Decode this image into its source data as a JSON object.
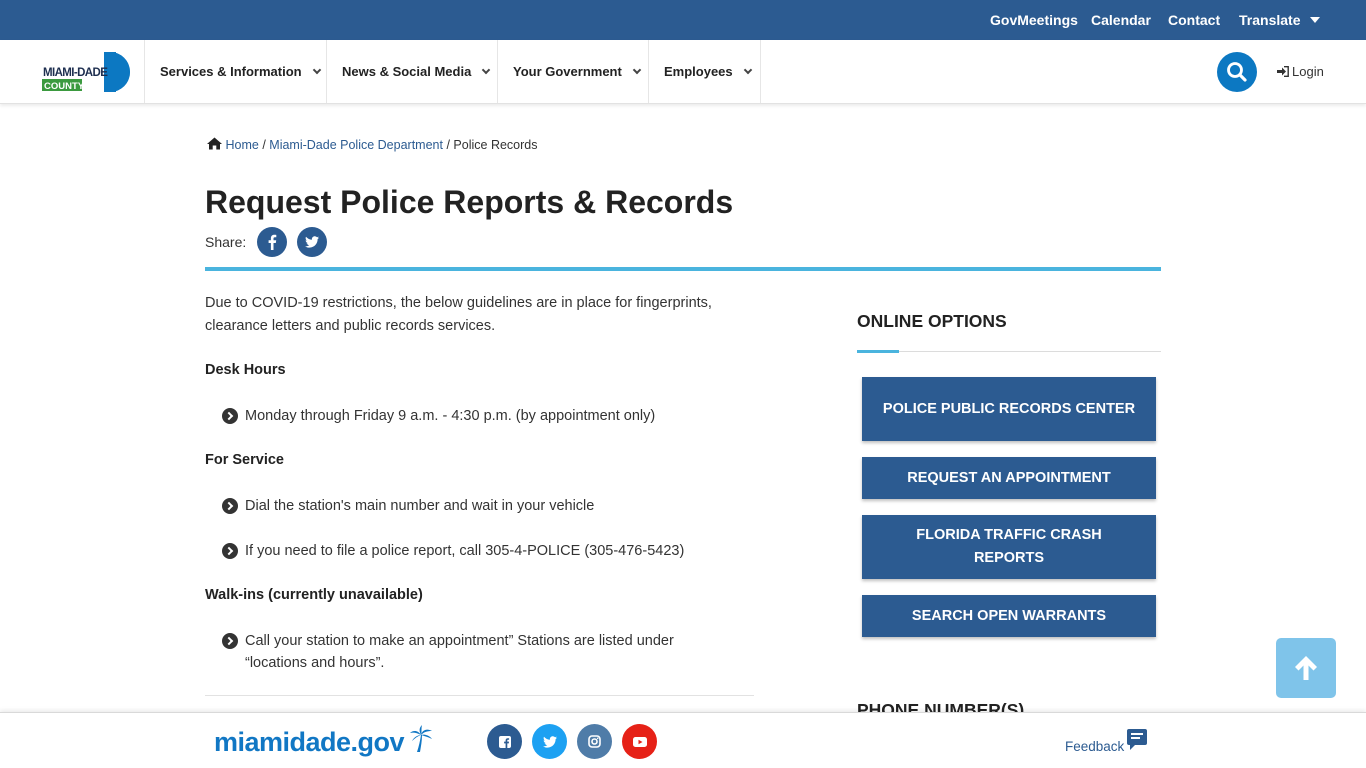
{
  "topbar": {
    "links": [
      "GovMeetings",
      "Calendar",
      "Contact"
    ],
    "translate_label": "Translate"
  },
  "logo": {
    "line1": "MIAMI-DADE",
    "line2": "COUNTY"
  },
  "nav": {
    "items": [
      "Services & Information",
      "News & Social Media",
      "Your Government",
      "Employees"
    ],
    "login_label": "Login"
  },
  "breadcrumb": {
    "home": "Home",
    "separator": "/",
    "department": "Miami-Dade Police Department",
    "current": "Police Records"
  },
  "page": {
    "title": "Request Police Reports & Records",
    "share_label": "Share:",
    "intro": "Due to COVID-19 restrictions, the below guidelines are in place for fingerprints, clearance letters and public records services.",
    "sections": [
      {
        "heading": "Desk Hours",
        "items": [
          "Monday through Friday 9 a.m. - 4:30 p.m. (by appointment only)"
        ]
      },
      {
        "heading": "For Service",
        "items": [
          "Dial the station's main number and wait in your vehicle",
          "If you need to file a police report, call 305-4-POLICE (305-476-5423)"
        ]
      },
      {
        "heading": "Walk-ins (currently unavailable)",
        "items": [
          "Call your station to make an appointment” Stations are listed under “locations and hours”."
        ]
      }
    ]
  },
  "sidebar": {
    "title": "ONLINE OPTIONS",
    "buttons": [
      "POLICE PUBLIC RECORDS CENTER",
      "REQUEST AN APPOINTMENT",
      "FLORIDA TRAFFIC CRASH REPORTS",
      "SEARCH OPEN WARRANTS"
    ],
    "next_title": "PHONE NUMBER(S)"
  },
  "footer": {
    "brand": "miamidade.gov",
    "feedback_label": "Feedback"
  },
  "colors": {
    "primary": "#2c5b91",
    "accent": "#4ab4de",
    "search": "#0c78c2",
    "facebook": "#2c5b91",
    "twitter": "#1da1f2",
    "instagram": "#4f7ca8",
    "youtube": "#e62117",
    "logo_green": "#3b9a3f"
  },
  "icons": {
    "share": [
      "facebook-icon",
      "twitter-icon"
    ],
    "social": [
      "facebook-icon",
      "twitter-icon",
      "instagram-icon",
      "youtube-icon"
    ]
  }
}
